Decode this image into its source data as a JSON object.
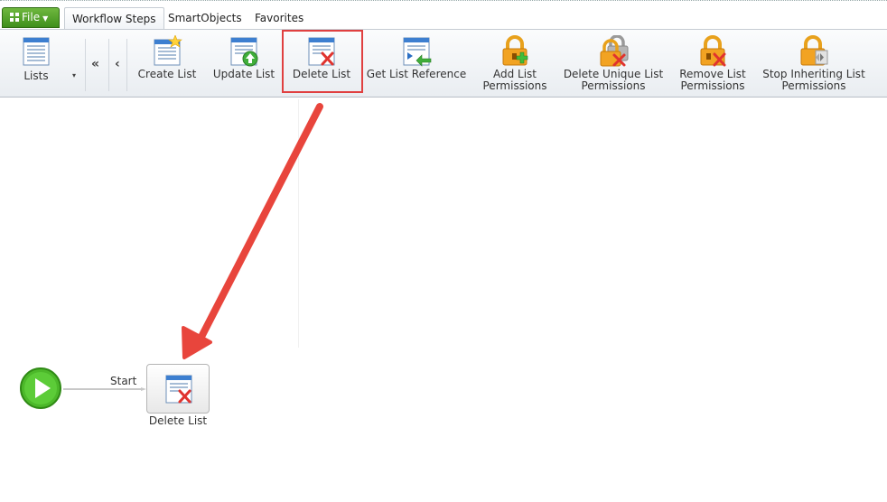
{
  "tabs": {
    "file_label": "File",
    "items": [
      "Workflow Steps",
      "SmartObjects",
      "Favorites"
    ]
  },
  "ribbon": {
    "lists_label": "Lists",
    "dropdown_glyph": "▾",
    "nav_first_glyph": "«",
    "nav_prev_glyph": "‹",
    "buttons": [
      {
        "line1": "Create List",
        "line2": ""
      },
      {
        "line1": "Update List",
        "line2": ""
      },
      {
        "line1": "Delete List",
        "line2": ""
      },
      {
        "line1": "Get List Reference",
        "line2": ""
      },
      {
        "line1": "Add List",
        "line2": "Permissions"
      },
      {
        "line1": "Delete Unique List",
        "line2": "Permissions"
      },
      {
        "line1": "Remove List",
        "line2": "Permissions"
      },
      {
        "line1": "Stop Inheriting List",
        "line2": "Permissions"
      }
    ]
  },
  "canvas": {
    "connector_label": "Start",
    "step_label": "Delete List"
  },
  "colors": {
    "highlight": "#e04040",
    "file_green": "#4a9a26",
    "start_green": "#4cb82a"
  }
}
